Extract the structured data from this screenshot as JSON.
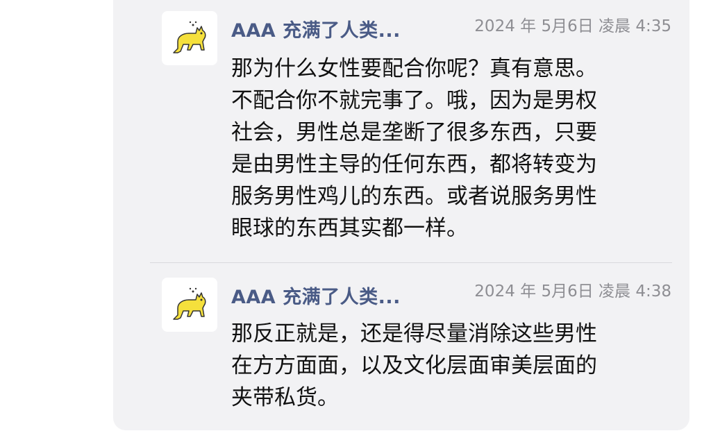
{
  "messages": [
    {
      "sender": "AAA 充满了人类...",
      "time": "2024 年 5月6日 凌晨 4:35",
      "avatar_icon": "yellow-cat-icon",
      "lines": [
        "那为什么女性要配合你呢？真有意思。",
        "不配合你不就完事了。哦，因为是男权",
        "社会，男性总是垄断了很多东西，只要",
        "是由男性主导的任何东西，都将转变为",
        "服务男性鸡儿的东西。或者说服务男性",
        "眼球的东西其实都一样。"
      ]
    },
    {
      "sender": "AAA 充满了人类...",
      "time": "2024 年 5月6日 凌晨 4:38",
      "avatar_icon": "yellow-cat-icon",
      "lines": [
        "那反正就是，还是得尽量消除这些男性",
        "在方方面面，以及文化层面审美层面的",
        "夹带私货。"
      ]
    }
  ],
  "colors": {
    "panel_bg": "#f2f2f4",
    "sender": "#4a5b86",
    "time": "#8e8e93",
    "cat": "#f5e03c"
  }
}
